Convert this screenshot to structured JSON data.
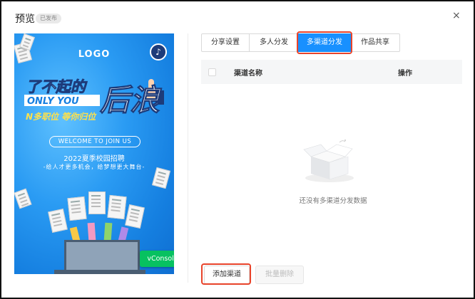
{
  "header": {
    "title": "预览",
    "status_badge": "已发布",
    "close_glyph": "×"
  },
  "poster": {
    "logo": "LOGO",
    "headline_line1": "了不起的",
    "headline_en": "ONLY YOU",
    "headline_big": "后浪",
    "tagline": "N多职位 等你归位",
    "welcome": "WELCOME TO JOIN US",
    "recruit_title": "2022夏季校园招聘",
    "recruit_subtitle": "-给人才更多机会，给梦想更大舞台-",
    "vconsole": "vConsole"
  },
  "tabs": [
    {
      "label": "分享设置",
      "active": false
    },
    {
      "label": "多人分发",
      "active": false
    },
    {
      "label": "多渠道分发",
      "active": true
    },
    {
      "label": "作品共享",
      "active": false
    }
  ],
  "table": {
    "columns": [
      "渠道名称",
      "操作"
    ]
  },
  "empty_state": {
    "text": "还没有多渠道分发数据",
    "icon": "empty-box-icon"
  },
  "footer": {
    "add_label": "添加渠道",
    "batch_delete_label": "批量删除"
  },
  "colors": {
    "primary": "#1890ff",
    "highlight": "#e8432a",
    "vconsole": "#07c160"
  }
}
